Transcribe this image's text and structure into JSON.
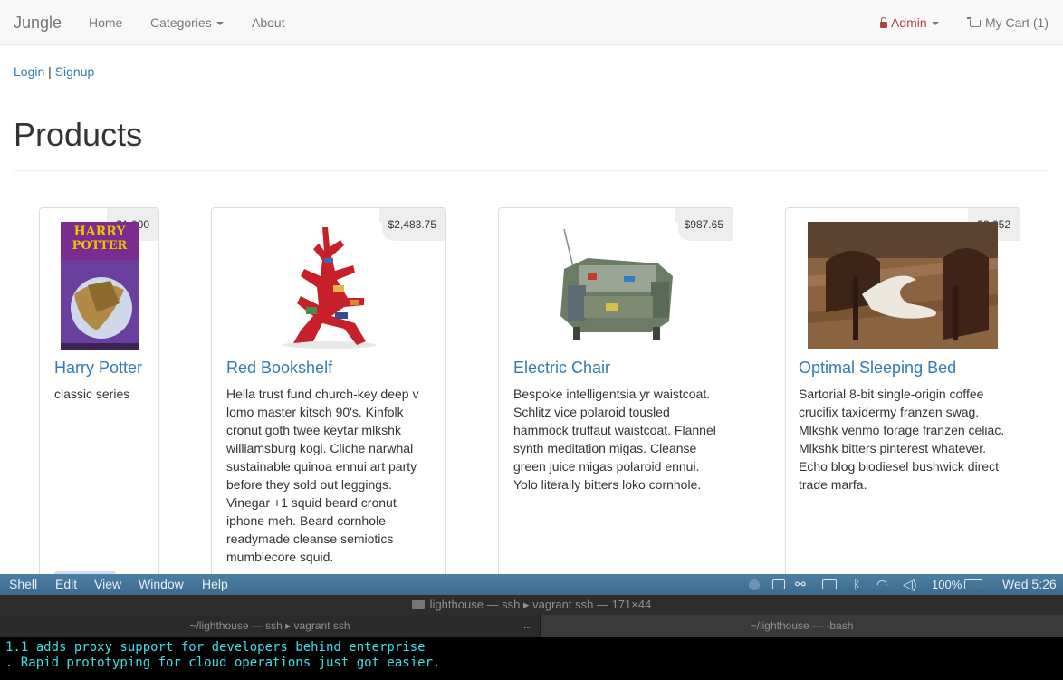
{
  "navbar": {
    "brand": "Jungle",
    "links": [
      "Home",
      "Categories",
      "About"
    ],
    "admin_label": "Admin",
    "cart_label": "My Cart (1)"
  },
  "auth": {
    "login": "Login",
    "separator": "|",
    "signup": "Signup"
  },
  "page_title": "Products",
  "products": [
    {
      "name": "Harry Potter",
      "price": "$1,000",
      "description": "classic series"
    },
    {
      "name": "Red Bookshelf",
      "price": "$2,483.75",
      "description": "Hella trust fund church-key deep v lomo master kitsch 90's. Kinfolk cronut goth twee keytar mlkshk williamsburg kogi. Cliche narwhal sustainable quinoa ennui art party before they sold out leggings. Vinegar +1 squid beard cronut iphone meh. Beard cornhole readymade cleanse semiotics mumblecore squid."
    },
    {
      "name": "Electric Chair",
      "price": "$987.65",
      "description": "Bespoke intelligentsia yr waistcoat. Schlitz vice polaroid tousled hammock truffaut waistcoat. Flannel synth meditation migas. Cleanse green juice migas polaroid ennui. Yolo literally bitters loko cornhole."
    },
    {
      "name": "Optimal Sleeping Bed",
      "price": "$3,052",
      "description": "Sartorial 8-bit single-origin coffee crucifix taxidermy franzen swag. Mlkshk venmo forage franzen celiac. Mlkshk bitters pinterest whatever. Echo blog biodiesel bushwick direct trade marfa."
    }
  ],
  "menubar": {
    "app": "Shell",
    "items": [
      "Edit",
      "View",
      "Window",
      "Help"
    ],
    "battery": "100%",
    "clock": "Wed 5:26"
  },
  "terminal": {
    "window_title": "lighthouse — ssh ▸ vagrant ssh — 171×44",
    "tab1": "~/lighthouse — ssh ▸ vagrant ssh",
    "tab2": "~/lighthouse — -bash",
    "tab_more": "...",
    "lines": [
      "1.1 adds proxy support for developers behind enterprise",
      ". Rapid prototyping for cloud operations just got easier."
    ]
  }
}
